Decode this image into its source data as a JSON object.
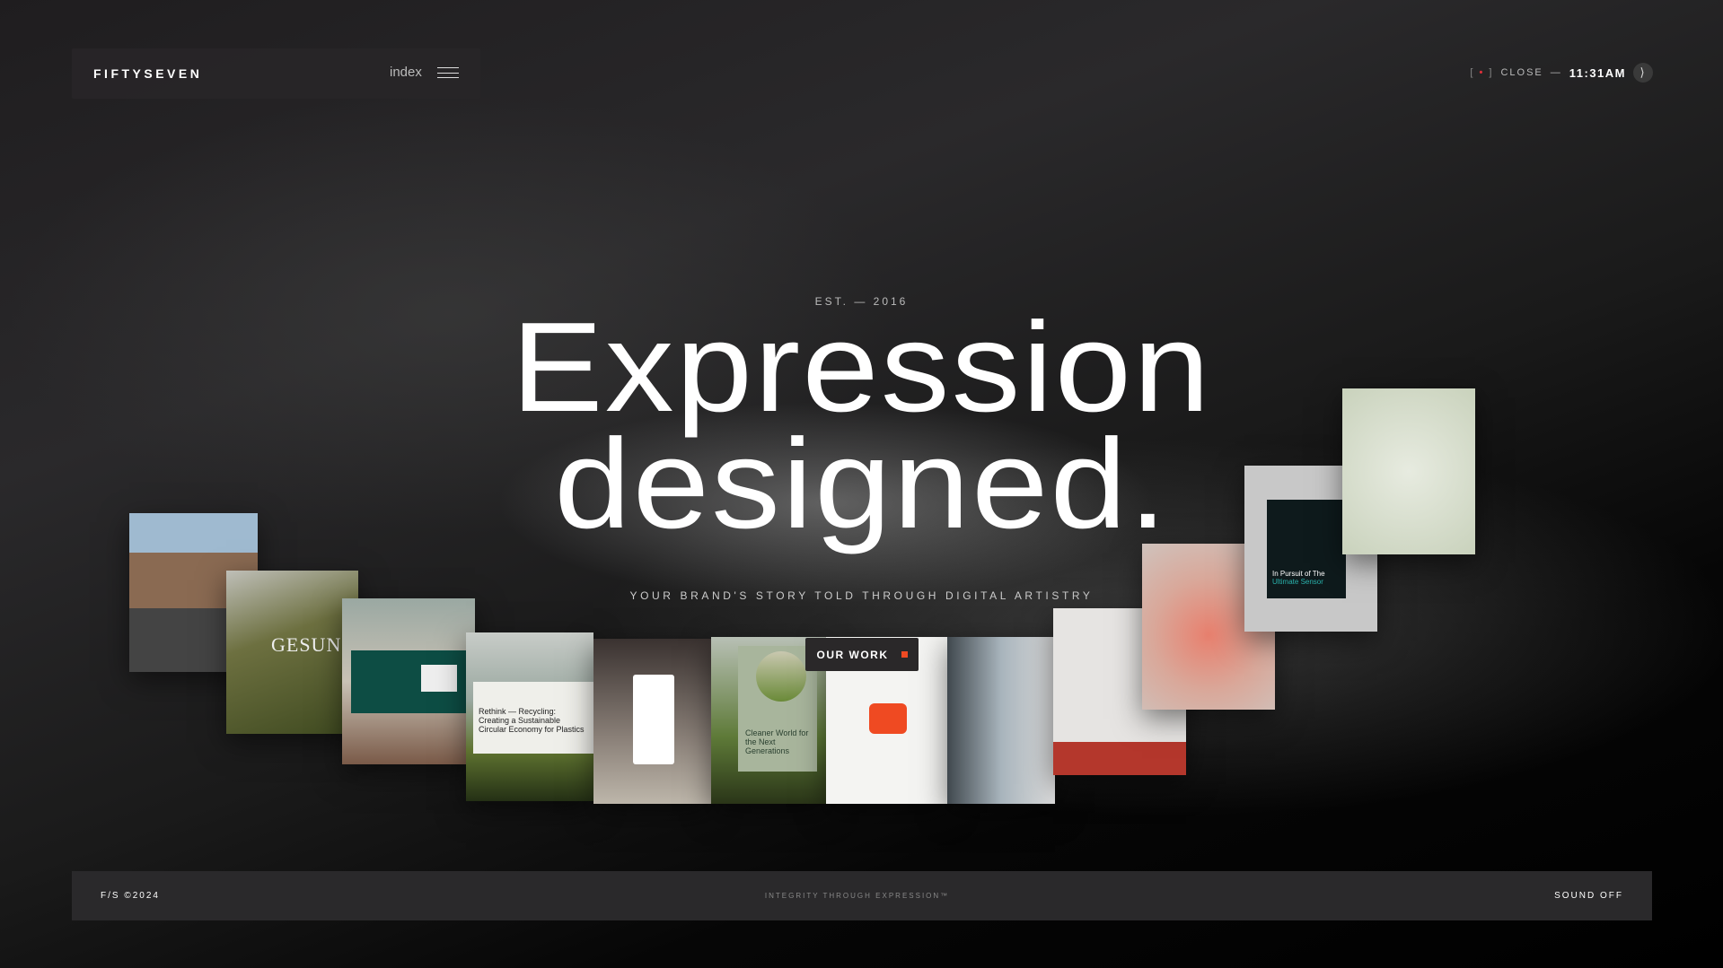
{
  "nav": {
    "logo": "FIFTYSEVEN",
    "index_label": "index",
    "menu_icon": "hamburger-icon"
  },
  "status": {
    "rec_open": "[",
    "rec_close": "]",
    "close_label": "CLOSE",
    "dash": "—",
    "time": "11:31AM",
    "next_icon": "chevron-right-icon",
    "rec_color": "#e0303a"
  },
  "hero": {
    "est": "EST.  —  2016",
    "title_line1": "Expression",
    "title_line2": "designed.",
    "subtitle": "YOUR BRAND'S STORY TOLD THROUGH DIGITAL ARTISTRY"
  },
  "tiles": {
    "gesund": "GESUND",
    "rethink": "Rethink — Recycling: Creating a Sustainable Circular Economy for Plastics",
    "cleaner": "Cleaner World for the Next Generations",
    "pursuit_a": "In Pursuit of The ",
    "pursuit_b": "Ultimate Sensor"
  },
  "cta": {
    "label": "OUR WORK",
    "accent": "#ef4a22"
  },
  "footer": {
    "left": "F/S ©2024",
    "center": "INTEGRITY THROUGH EXPRESSION™",
    "right": "SOUND OFF"
  }
}
